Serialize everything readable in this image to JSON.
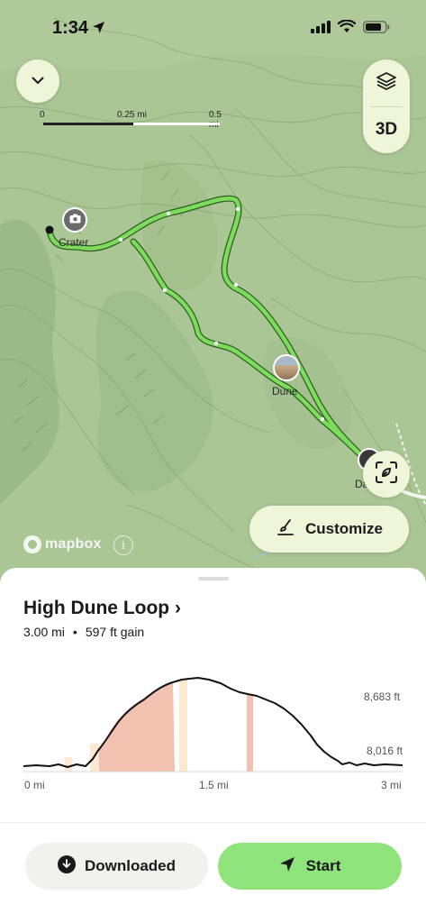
{
  "status_bar": {
    "time": "1:34"
  },
  "map": {
    "scale": {
      "labels": [
        "0",
        "0.25 mi",
        "0.5 mi"
      ]
    },
    "layers_button": {
      "icon": "layers-icon"
    },
    "view_3d_label": "3D",
    "waypoints": [
      {
        "name": "Crater",
        "icon": "camera-icon"
      },
      {
        "name": "Dune",
        "icon": "photo-thumbnail"
      },
      {
        "name": "Da",
        "icon": "trailhead-marker"
      }
    ],
    "attribution": "mapbox",
    "customize_label": "Customize",
    "colors": {
      "trail": "#7ddc5e",
      "trail_outline": "#2f5e20",
      "map_bg": "#a9c493"
    }
  },
  "trail": {
    "title": "High Dune Loop",
    "title_chevron": "›",
    "distance": "3.00 mi",
    "separator": "•",
    "gain": "597 ft gain"
  },
  "elevation_profile": {
    "y_labels": [
      "8,683 ft",
      "8,016 ft"
    ],
    "x_labels": [
      "0 mi",
      "1.5 mi",
      "3 mi"
    ],
    "colors": {
      "steep": "#f3c1b0",
      "moderate": "#fbe9d0",
      "line": "#111111"
    }
  },
  "actions": {
    "downloaded_label": "Downloaded",
    "start_label": "Start"
  }
}
